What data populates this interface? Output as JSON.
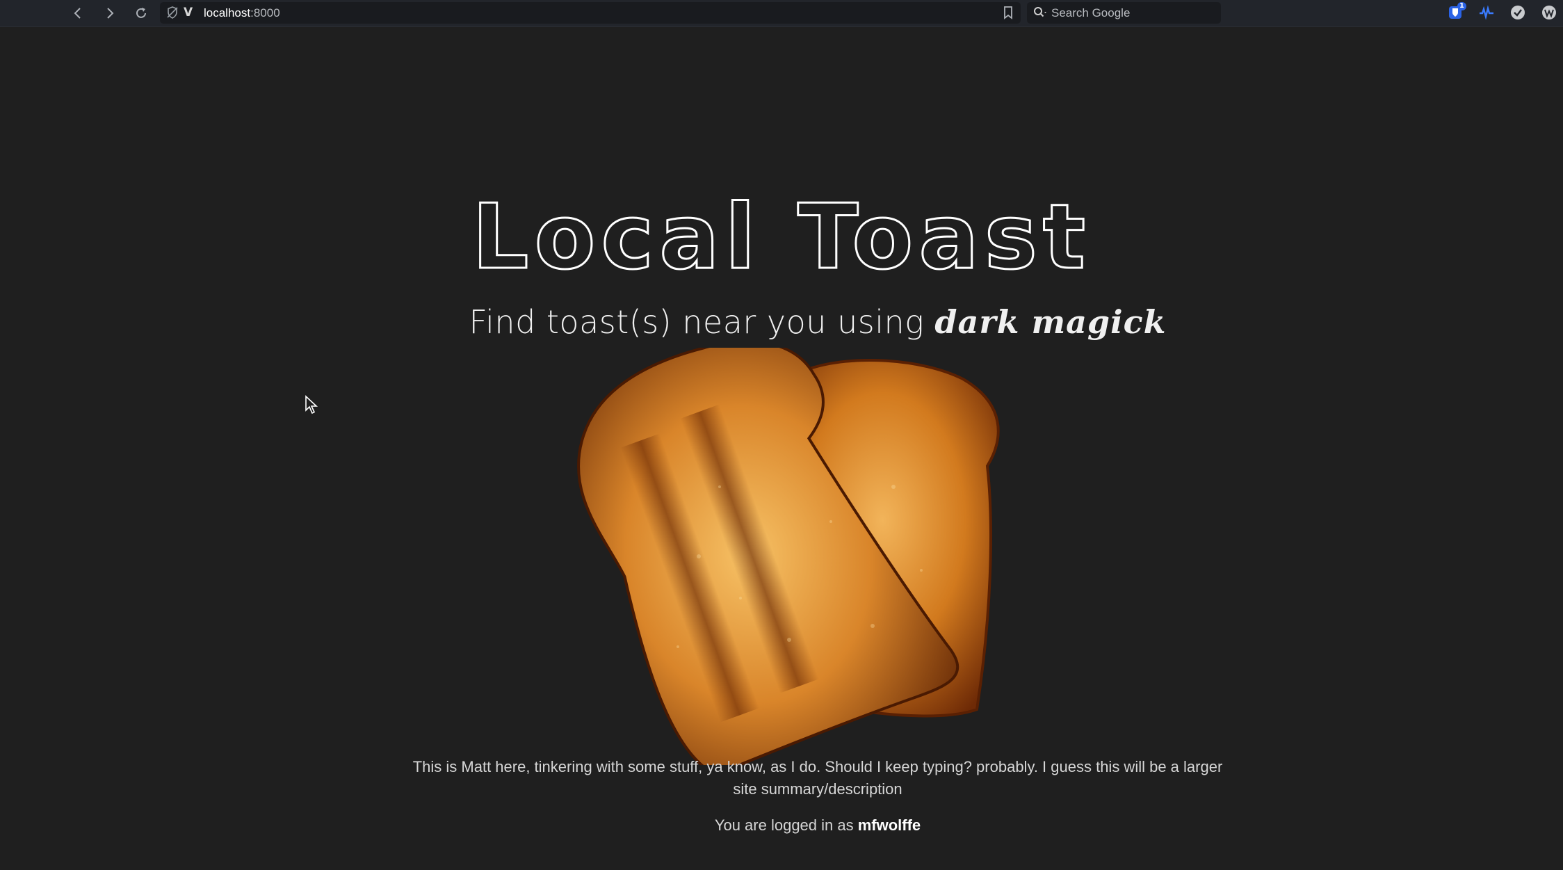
{
  "browser": {
    "url_host": "localhost",
    "url_port": ":8000",
    "url_prefix": "V",
    "search_placeholder": "Search Google",
    "extension_badge": "1"
  },
  "page": {
    "title": "Local Toast",
    "subtitle_prefix": "Find toast(s) near you using ",
    "subtitle_emphasis": "dark magick",
    "description": "This is Matt here, tinkering with some stuff, ya know, as I do. Should I keep typing? probably. I guess this will be a larger site summary/description",
    "login_prefix": "You are logged in as ",
    "username": "mfwolffe"
  },
  "colors": {
    "background": "#1f1f1f",
    "chrome": "#22252b",
    "toast_light": "#e8a43a",
    "toast_dark": "#7a3408"
  },
  "icons": [
    "back-arrow-icon",
    "forward-arrow-icon",
    "reload-icon",
    "shield-off-icon",
    "bookmark-icon",
    "search-icon",
    "bitwarden-icon",
    "extension-wave-icon",
    "extension-check-icon",
    "extension-w-icon",
    "mouse-cursor-icon",
    "toast-image"
  ]
}
